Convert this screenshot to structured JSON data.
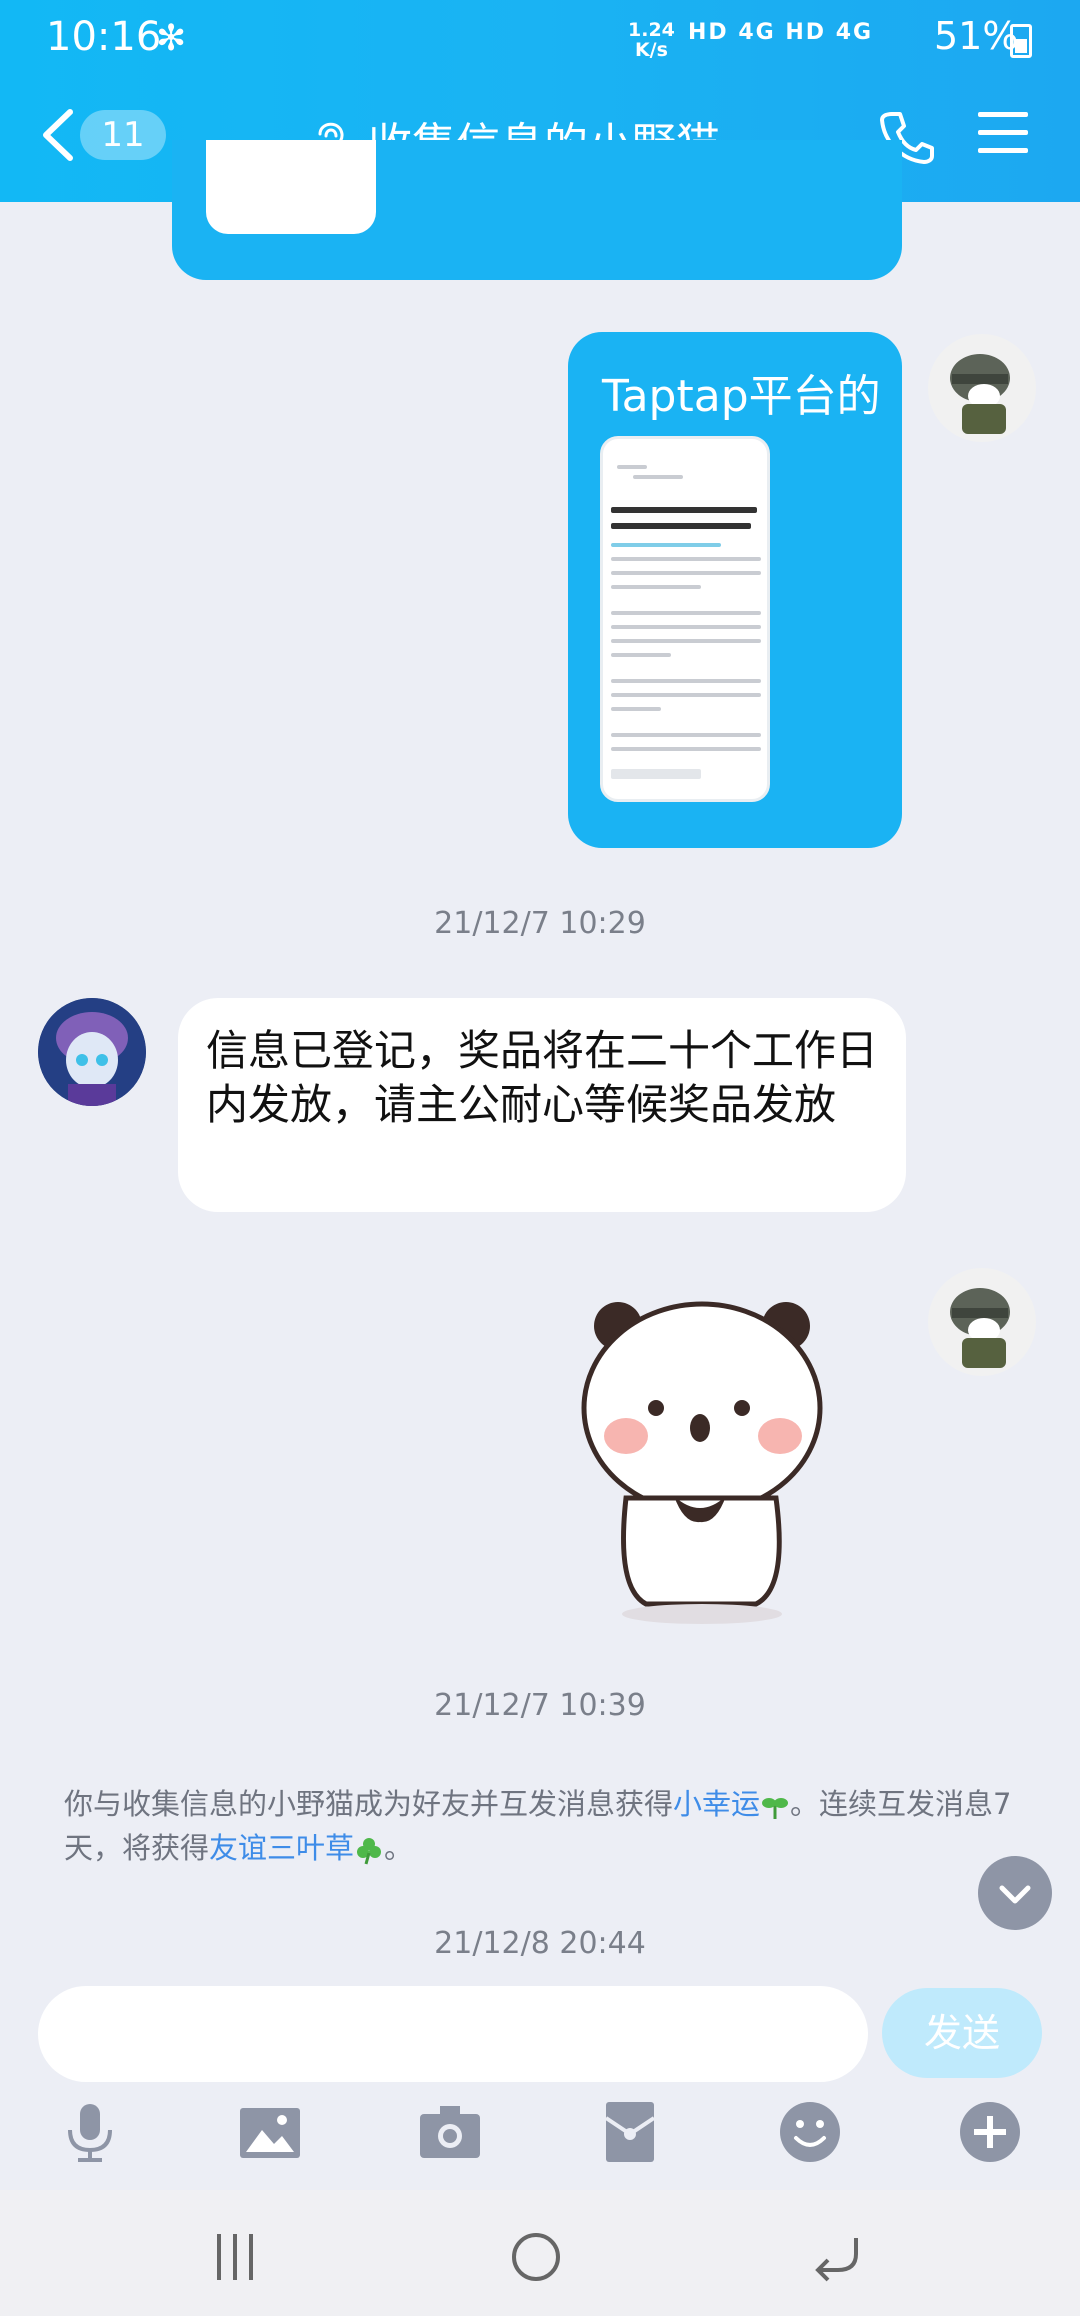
{
  "status_bar": {
    "time": "10:16",
    "net_speed_value": "1.24",
    "net_speed_unit": "K/s",
    "signal_text": "HD 4G HD 4G",
    "battery": "51%"
  },
  "header": {
    "unread_count": "11",
    "title": "收集信息的小野猫"
  },
  "messages": {
    "taptap_caption": "Taptap平台的",
    "reply_text": "信息已登记，奖品将在二十个工作日内发放，请主公耐心等候奖品发放"
  },
  "timestamps": {
    "t1": "21/12/7 10:29",
    "t2": "21/12/7 10:39",
    "t3": "21/12/8 20:44"
  },
  "notice": {
    "part1": "你与收集信息的小野猫成为好友并互发消息获得",
    "link1": "小幸运",
    "part2": "。连续互发消息7天，将获得",
    "link2": "友谊三叶草",
    "part3": "。"
  },
  "input": {
    "send_label": "发送"
  },
  "colors": {
    "header": "#1ab3f3",
    "bubble_self": "#1ab3f3",
    "background": "#eceef5",
    "link": "#3e8ce8"
  },
  "icons": [
    "back-icon",
    "ear-icon",
    "phone-icon",
    "menu-icon",
    "mic-icon",
    "image-icon",
    "camera-icon",
    "redpacket-icon",
    "emoji-icon",
    "plus-icon"
  ]
}
